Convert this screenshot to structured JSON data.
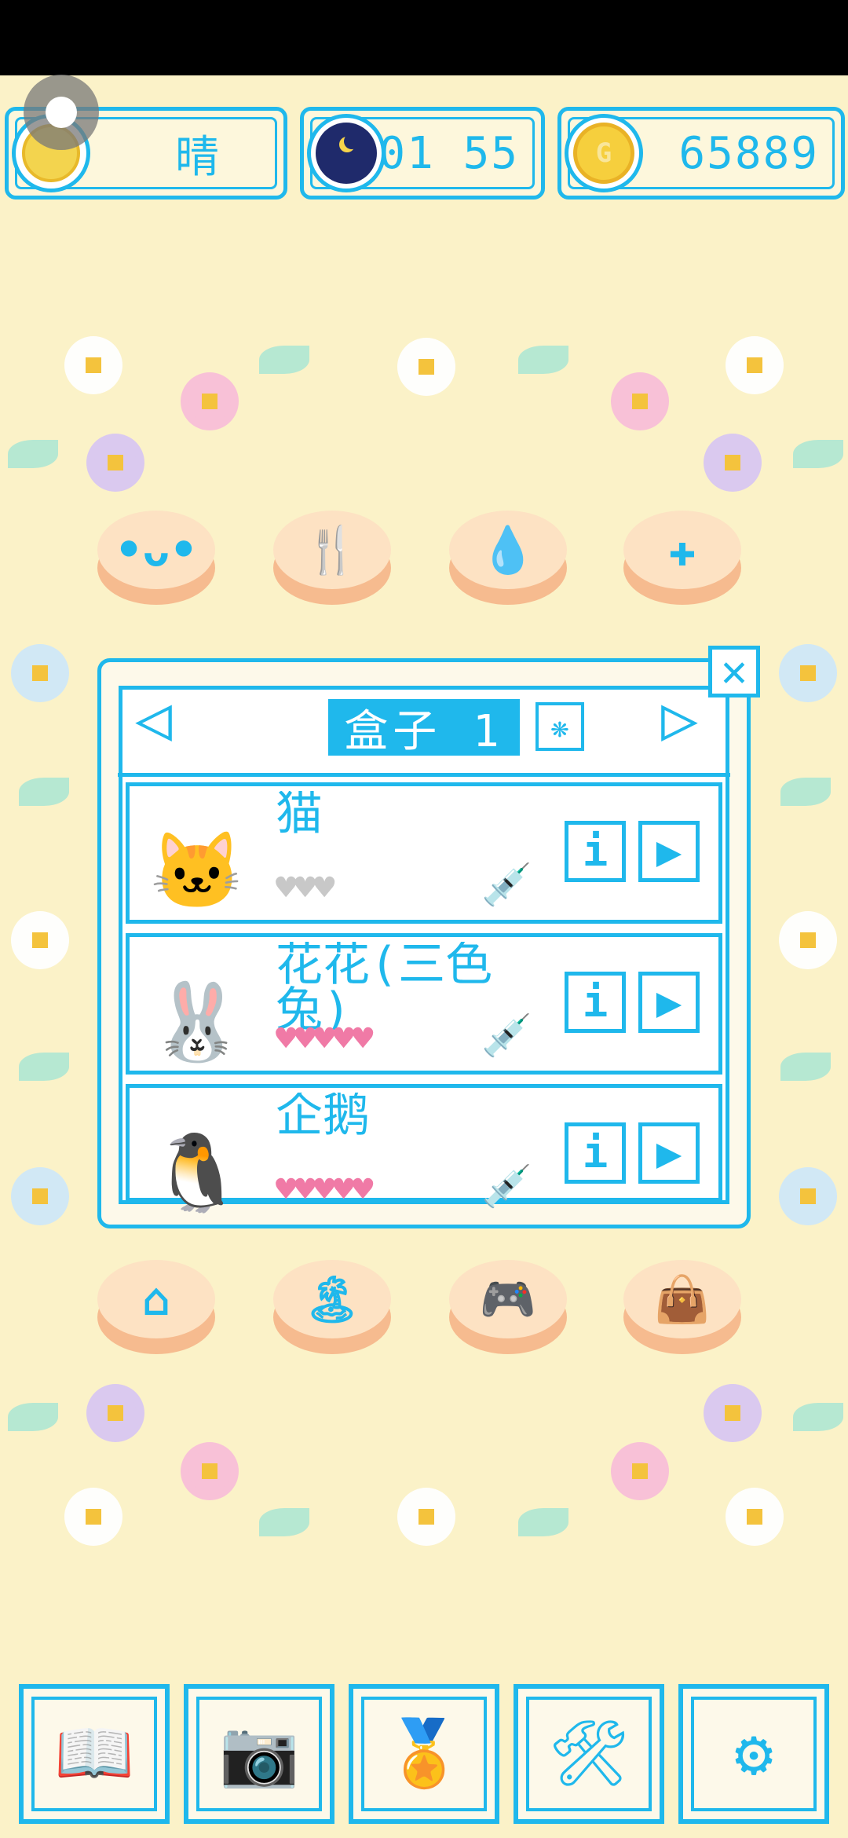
{
  "status": {
    "weather": "晴",
    "time": "01 55",
    "coins": "65889",
    "coin_symbol": "G"
  },
  "actions_top": [
    {
      "name": "slime",
      "icon": "•ᴗ•"
    },
    {
      "name": "feed",
      "icon": "🍴"
    },
    {
      "name": "water",
      "icon": "💧"
    },
    {
      "name": "heal",
      "icon": "✚"
    }
  ],
  "box": {
    "title": "盒子 1",
    "gear_icon": "❋",
    "prev_icon": "◁",
    "next_icon": "▷",
    "close_icon": "✕",
    "pets": [
      {
        "name": "猫",
        "avatar": "🐱",
        "hearts": "♥♥♥",
        "hearts_color": "#c8c8c8",
        "info": "i",
        "play": "▶",
        "syringe": "💉"
      },
      {
        "name": "花花(三色兔)",
        "avatar": "🐰",
        "hearts": "♥♥♥♥♥",
        "hearts_color": "#f07aa6",
        "info": "i",
        "play": "▶",
        "syringe": "💉"
      },
      {
        "name": "企鹅",
        "avatar": "🐧",
        "hearts": "♥♥♥♥♥",
        "hearts_color": "#f07aa6",
        "info": "i",
        "play": "▶",
        "syringe": "💉"
      }
    ]
  },
  "actions_bottom": [
    {
      "name": "home",
      "icon": "⌂"
    },
    {
      "name": "island",
      "icon": "🏝"
    },
    {
      "name": "game",
      "icon": "🎮"
    },
    {
      "name": "shop",
      "icon": "👜"
    }
  ],
  "toolbar": [
    {
      "name": "book",
      "icon": "📖"
    },
    {
      "name": "camera",
      "icon": "📷"
    },
    {
      "name": "medal",
      "icon": "🏅"
    },
    {
      "name": "tools",
      "icon": "🛠"
    },
    {
      "name": "settings",
      "icon": "⚙"
    }
  ],
  "colors": {
    "accent": "#1fb8ec",
    "background": "#fbf2c8",
    "heart_pink": "#f07aa6",
    "heart_gray": "#c8c8c8"
  }
}
